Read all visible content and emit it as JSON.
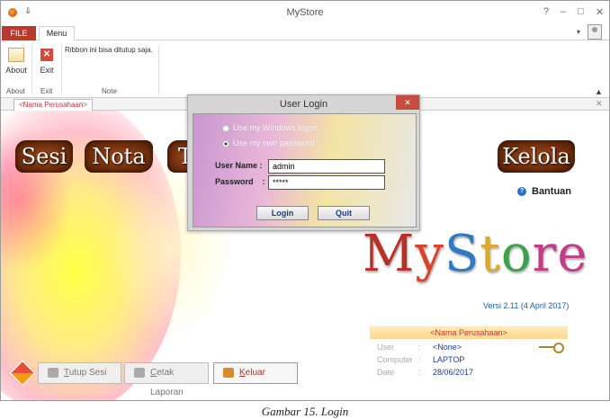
{
  "window": {
    "title": "MyStore",
    "help": "?",
    "minimize": "–",
    "restore": "□",
    "close": "✕",
    "qat": "⇓"
  },
  "ribbon": {
    "tabs": [
      "FILE",
      "Menu"
    ],
    "groups": [
      {
        "label": "About",
        "button": "About"
      },
      {
        "label": "Exit",
        "button": "Exit"
      },
      {
        "label": "Note",
        "text": "Ribbon ini bisa ditutup saja."
      }
    ]
  },
  "doc_tab": {
    "label": "<Nama Perusahaan>"
  },
  "nav": {
    "sesi": "Sesi",
    "nota": "Nota",
    "third": "T",
    "kelola": "Kelola"
  },
  "bantuan": "Bantuan",
  "logo": {
    "parts": [
      "M",
      "y",
      "S",
      "t",
      "o",
      "re"
    ]
  },
  "versi": "Versi 2.11 (4 April 2017)",
  "info": {
    "header": "<Nama Perusahaan>",
    "rows": [
      {
        "key": "User",
        "value": "<None>"
      },
      {
        "key": "Computer",
        "value": "LAPTOP"
      },
      {
        "key": "Date",
        "value": "28/06/2017"
      }
    ],
    "colon": ":"
  },
  "bottom_buttons": [
    {
      "label": "Tutup Sesi",
      "accel": "T",
      "rest": "utup Sesi"
    },
    {
      "label": "Cetak Laporan",
      "accel": "C",
      "rest": "etak Laporan"
    },
    {
      "label": "Keluar",
      "accel": "K",
      "rest": "eluar"
    }
  ],
  "dialog": {
    "title": "User Login",
    "close": "✕",
    "radio1": "Use my Windows logon",
    "radio2": "Use my own password",
    "username_label": "User Name",
    "password_label": "Password",
    "colon": ":",
    "username_value": "admin",
    "password_value": "*****",
    "login": "Login",
    "quit": "Quit"
  },
  "caption": "Gambar 15. Login"
}
